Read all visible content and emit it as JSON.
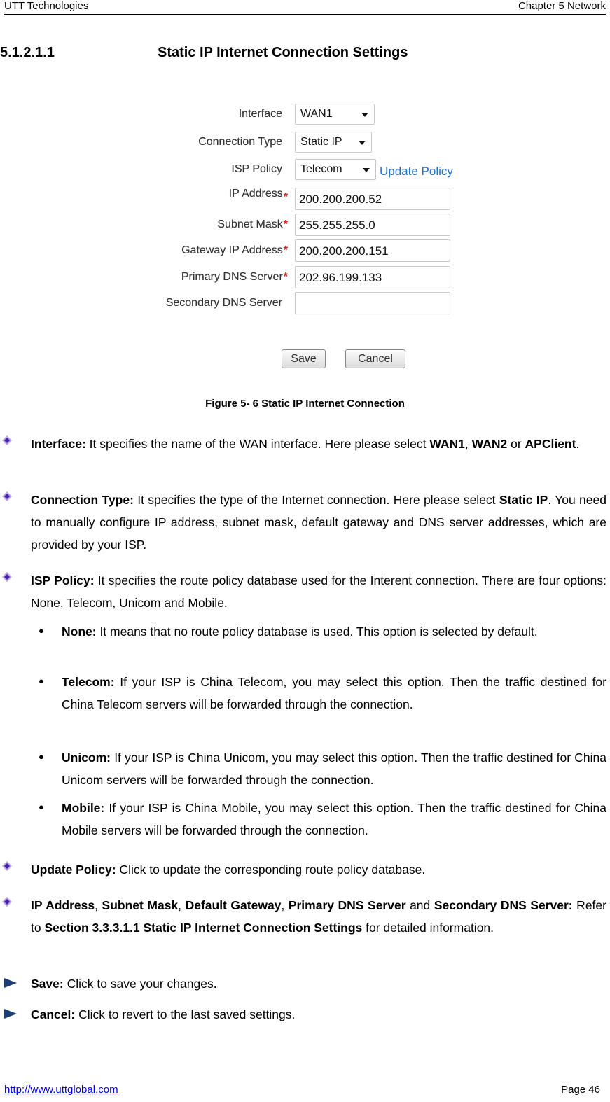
{
  "header": {
    "company": "UTT Technologies",
    "chapter": "Chapter 5 Network"
  },
  "section": {
    "number": "5.1.2.1.1",
    "title": "Static IP Internet Connection Settings"
  },
  "figure": {
    "fields": [
      {
        "label": "Interface",
        "type": "select",
        "value": "WAN1",
        "required": false
      },
      {
        "label": "Connection Type",
        "type": "select",
        "value": "Static IP",
        "required": false
      },
      {
        "label": "ISP Policy",
        "type": "select",
        "value": "Telecom",
        "required": false
      },
      {
        "label": "IP Address",
        "type": "text",
        "value": "200.200.200.52",
        "required": true
      },
      {
        "label": "Subnet Mask",
        "type": "text",
        "value": "255.255.255.0",
        "required": true
      },
      {
        "label": "Gateway IP Address",
        "type": "text",
        "value": "200.200.200.151",
        "required": true
      },
      {
        "label": "Primary DNS Server",
        "type": "text",
        "value": "202.96.199.133",
        "required": true
      },
      {
        "label": "Secondary DNS Server",
        "type": "text",
        "value": "",
        "required": false
      }
    ],
    "required_mark": "*",
    "update_policy_link": "Update Policy",
    "save_label": "Save",
    "cancel_label": "Cancel",
    "caption": "Figure 5- 6 Static IP Internet Connection"
  },
  "items": {
    "interface": {
      "term": "Interface:",
      "text1": " It specifies the name of the WAN interface. Here please select ",
      "b1": "WAN1",
      "t2": ",",
      "b2": "WAN2",
      "t3": " or ",
      "b3": "APClient",
      "t4": "."
    },
    "conn_type": {
      "term": "Connection Type:",
      "text1": " It specifies the type of the Internet connection. Here please select ",
      "b1": "Static IP",
      "text2": ". You need to manually configure IP address, subnet mask, default gateway and DNS server addresses, which are provided by your ISP."
    },
    "isp_policy": {
      "term": "ISP Policy:",
      "text": " It specifies the route policy database used for the Interent connection. There are four options: None, Telecom, Unicom and Mobile."
    },
    "options": [
      {
        "term": "None:",
        "text": " It means that no route policy database is used. This option is selected by default."
      },
      {
        "term": "Telecom:",
        "text": " If your ISP is China Telecom, you may select this option. Then the traffic destined for China Telecom servers will be forwarded through the connection."
      },
      {
        "term": "Unicom:",
        "text": " If your ISP is China Unicom, you may select this option. Then the traffic destined for China Unicom servers will be forwarded through the connection."
      },
      {
        "term": "Mobile:",
        "text": " If your ISP is China Mobile, you may select this option. Then the traffic destined for China Mobile servers will be forwarded through the connection."
      }
    ],
    "bullet_glyph": "●",
    "update_policy": {
      "term": "Update Policy:",
      "text": " Click to update the corresponding route policy database."
    },
    "ip_fields": {
      "b1": "IP Address",
      "t1": ", ",
      "b2": "Subnet Mask",
      "t2": ", ",
      "b3": "Default Gateway",
      "t3": ", ",
      "b4": "Primary DNS Server",
      "t4": " and ",
      "b5": "Secondary DNS Server:",
      "t5": " Refer to ",
      "b6": "Section 3.3.3.1.1 Static IP Internet Connection Settings",
      "t6": " for detailed information."
    },
    "save": {
      "term": "Save:",
      "text": " Click to save your changes."
    },
    "cancel": {
      "term": "Cancel:",
      "text": " Click to revert to the last saved settings."
    }
  },
  "footer": {
    "url": "http://www.uttglobal.com",
    "page": "Page 46"
  },
  "colors": {
    "link": "#1a73d6",
    "required": "#e02020",
    "diamond": "#4a1fa8",
    "arrow": "#1d3f73"
  }
}
